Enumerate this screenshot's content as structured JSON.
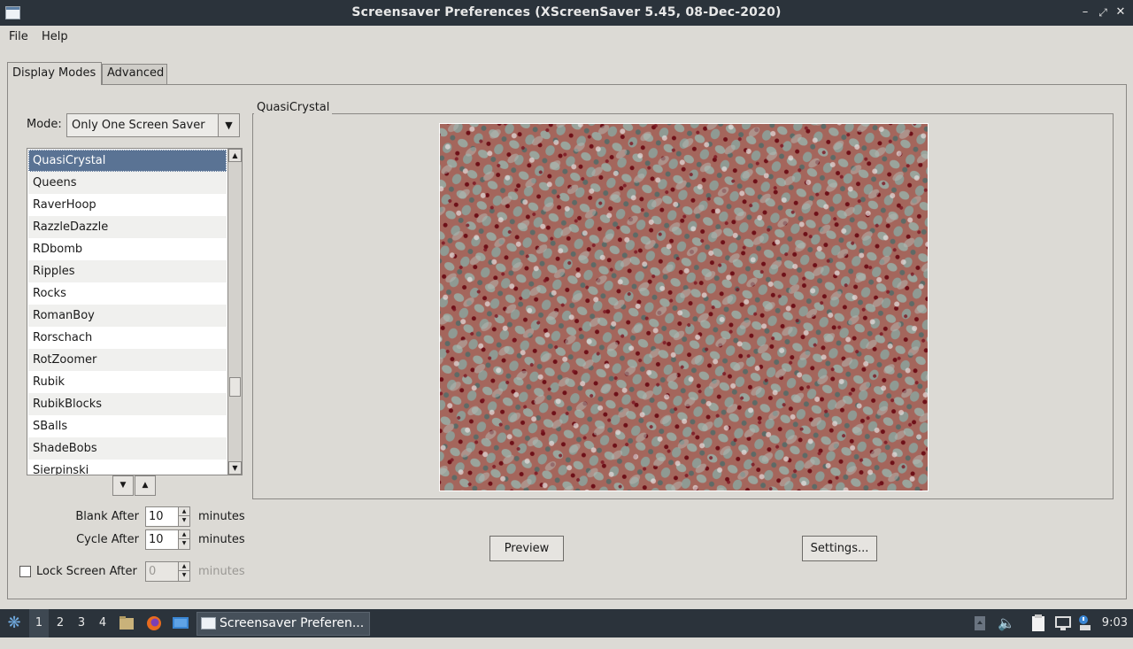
{
  "window": {
    "title": "Screensaver Preferences  (XScreenSaver 5.45, 08-Dec-2020)"
  },
  "menu": {
    "file": "File",
    "help": "Help"
  },
  "tabs": {
    "display_modes": "Display Modes",
    "advanced": "Advanced"
  },
  "mode": {
    "label": "Mode:",
    "value": "Only One Screen Saver"
  },
  "savers": [
    "QuasiCrystal",
    "Queens",
    "RaverHoop",
    "RazzleDazzle",
    "RDbomb",
    "Ripples",
    "Rocks",
    "RomanBoy",
    "Rorschach",
    "RotZoomer",
    "Rubik",
    "RubikBlocks",
    "SBalls",
    "ShadeBobs",
    "Sierpinski"
  ],
  "selected_saver": "QuasiCrystal",
  "blank": {
    "label": "Blank After",
    "value": "10",
    "unit": "minutes"
  },
  "cycle": {
    "label": "Cycle After",
    "value": "10",
    "unit": "minutes"
  },
  "lock": {
    "label": "Lock Screen After",
    "value": "0",
    "unit": "minutes",
    "checked": false
  },
  "preview_frame_label": "QuasiCrystal",
  "buttons": {
    "preview": "Preview",
    "settings": "Settings..."
  },
  "taskbar": {
    "workspaces": [
      "1",
      "2",
      "3",
      "4"
    ],
    "active_workspace": "1",
    "task_label": "Screensaver Preferen...",
    "clock": "9:03"
  },
  "colors": {
    "titlebar": "#2b333b",
    "selection": "#5a7394",
    "window_bg": "#dcdad5"
  }
}
